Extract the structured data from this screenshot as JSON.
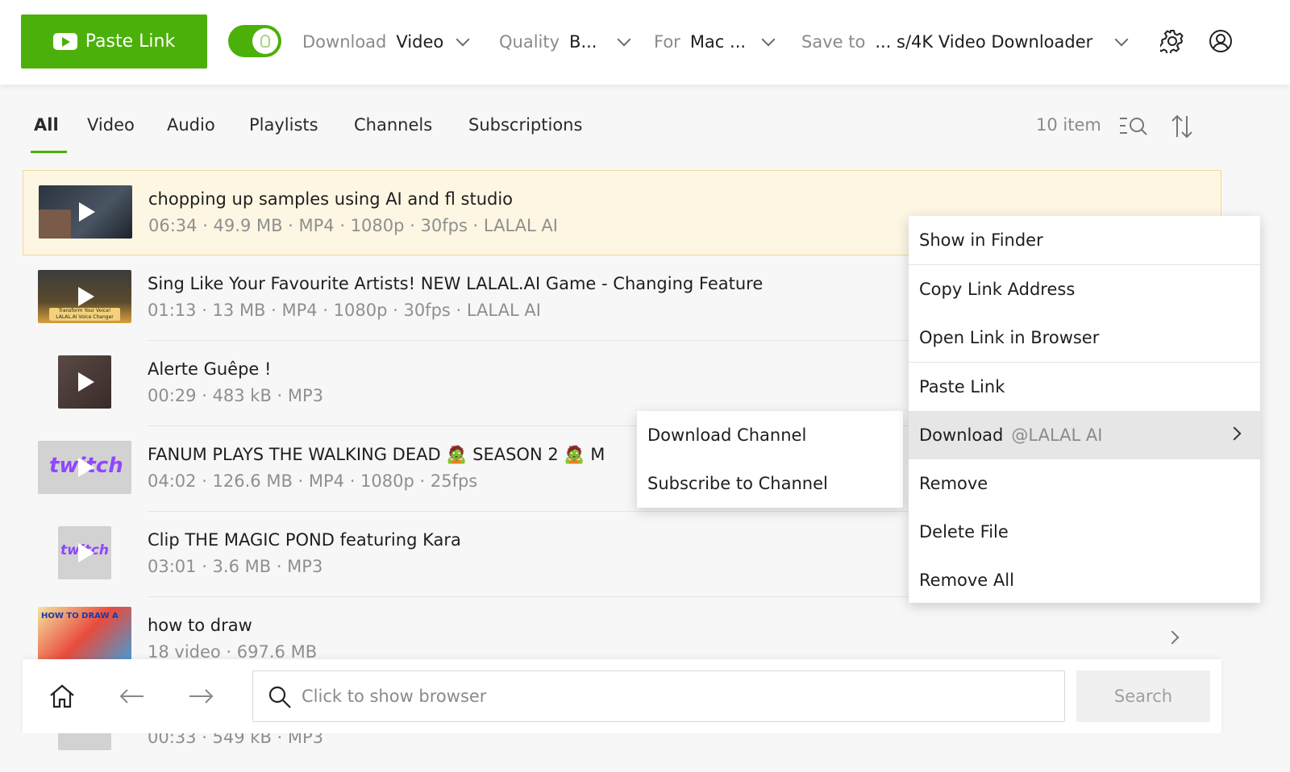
{
  "toolbar": {
    "paste_link": "Paste Link",
    "download_label": "Download",
    "download_value": "Video",
    "quality_label": "Quality",
    "quality_value": "B...",
    "for_label": "For",
    "for_value": "Mac ...",
    "save_label": "Save to",
    "save_value": "... s/4K Video Downloader"
  },
  "tabs": [
    "All",
    "Video",
    "Audio",
    "Playlists",
    "Channels",
    "Subscriptions"
  ],
  "item_count": "10 item",
  "items": [
    {
      "title": "chopping up samples using AI and fl studio",
      "meta": "06:34 · 49.9 MB · MP4 · 1080p · 30fps · LALAL AI"
    },
    {
      "title": "Sing Like Your Favourite Artists! NEW LALAL.AI Game - Changing Feature",
      "meta": "01:13 · 13 MB · MP4 · 1080p · 30fps · LALAL AI"
    },
    {
      "title": "Alerte Guêpe !",
      "meta": "00:29 · 483 kB · MP3"
    },
    {
      "title": "FANUM PLAYS THE WALKING DEAD 🧟 SEASON 2 🧟 M",
      "meta": "04:02 · 126.6 MB · MP4 · 1080p · 25fps"
    },
    {
      "title": "Clip THE MAGIC POND featuring Kara",
      "meta": "03:01 · 3.6 MB · MP3"
    },
    {
      "title": "how to draw",
      "meta": "18 video · 697.6 MB"
    },
    {
      "title": "",
      "meta": "00:33 · 549 kB · MP3"
    }
  ],
  "context_menu": {
    "show_in_finder": "Show in Finder",
    "copy_link": "Copy Link Address",
    "open_link": "Open Link in Browser",
    "paste_link": "Paste Link",
    "download": "Download",
    "download_channel": "@LALAL AI",
    "remove": "Remove",
    "delete_file": "Delete File",
    "remove_all": "Remove All"
  },
  "submenu": {
    "download_channel": "Download Channel",
    "subscribe_channel": "Subscribe to Channel"
  },
  "bottombar": {
    "placeholder": "Click to show browser",
    "search": "Search"
  },
  "thumb_text": {
    "item2": "Transform Your Voice! LALAL.AI Voice Changer",
    "twitch": "twitch",
    "draw": "HOW TO DRAW A"
  },
  "colors": {
    "accent": "#4cb00a",
    "selected_row": "#fdf6e3",
    "twitch": "#9146ff"
  }
}
